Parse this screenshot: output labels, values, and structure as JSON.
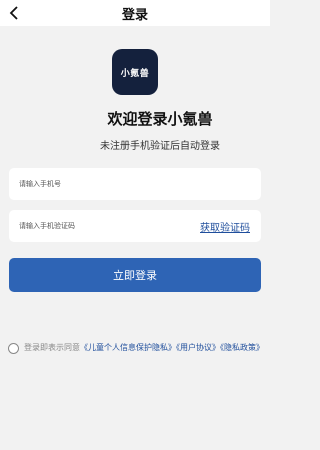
{
  "header": {
    "back_icon": "chevron-left-icon",
    "title": "登录"
  },
  "logo": {
    "text": "小氪兽",
    "bg_color": "#14213d"
  },
  "welcome_title": "欢迎登录小氪兽",
  "subtitle": "未注册手机验证后自动登录",
  "phone_field": {
    "value": "",
    "placeholder": "请输入手机号"
  },
  "code_field": {
    "value": "",
    "placeholder": "请输入手机验证码"
  },
  "get_code_label": "获取验证码",
  "login_button": {
    "label": "立即登录",
    "color": "#2e64b5"
  },
  "agreement": {
    "prefix": "登录即表示同意",
    "child_privacy": "《儿童个人信息保护隐私》",
    "user_agreement": "《用户协议》",
    "privacy_policy": "《隐私政策》",
    "link_color": "#1f4e9c"
  }
}
